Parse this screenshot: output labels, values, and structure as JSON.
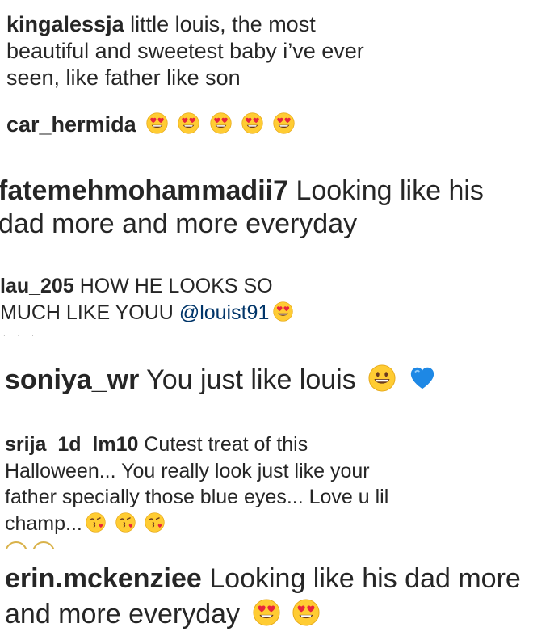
{
  "comments": [
    {
      "username": "kingalessja",
      "text": "little louis, the most beautiful and sweetest baby i’ve ever seen, like father like son"
    },
    {
      "username": "car_hermida",
      "text": ""
    },
    {
      "username": "fatemehmohammadii7",
      "text": "Looking like his dad more and more everyday"
    },
    {
      "username": "lau_205",
      "text": "HOW HE LOOKS SO MUCH LIKE YOUU",
      "mention": "@louist91"
    },
    {
      "username": "soniya_wr",
      "text": "You just like louis"
    },
    {
      "username": "srija_1d_lm10",
      "text": "Cutest treat of this Halloween... You really look just like your father specially those blue eyes... Love u lil champ..."
    },
    {
      "username": "erin.mckenziee",
      "text": "Looking like his dad more and more everyday"
    }
  ],
  "emojis": {
    "heart_eyes": "smiling-face-with-heart-eyes-icon",
    "grinning": "grinning-face-icon",
    "blue_heart": "blue-heart-icon",
    "kiss": "face-blowing-a-kiss-icon"
  },
  "colors": {
    "text": "#262626",
    "mention": "#003569",
    "emoji_face": "#FFCC33",
    "heart": "#E8243C",
    "blue_heart": "#1E88E5"
  }
}
